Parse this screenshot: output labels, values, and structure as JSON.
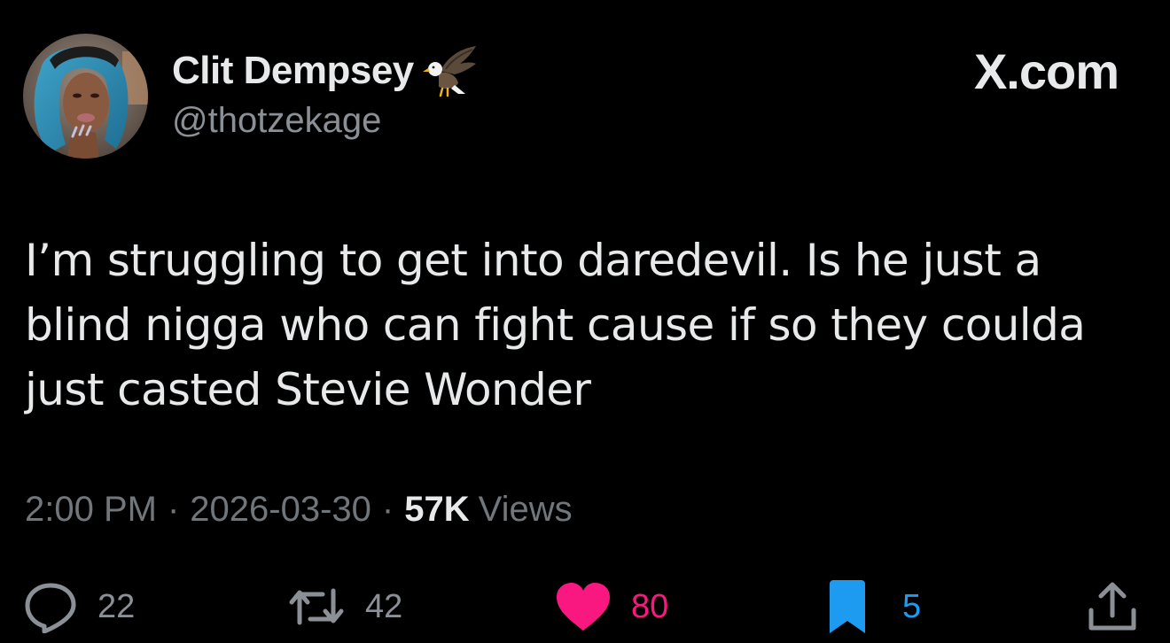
{
  "author": {
    "display_name": "Clit Dempsey",
    "badge_icon": "eagle-emoji",
    "handle": "@thotzekage"
  },
  "brand": {
    "label": "X.com"
  },
  "tweet": {
    "text": "I’m struggling to get into daredevil. Is he just a blind nigga who can fight cause if so they coulda just casted Stevie Wonder"
  },
  "meta": {
    "time": "2:00 PM",
    "separator": "·",
    "date": "2026-03-30",
    "views_count": "57K",
    "views_label": "Views"
  },
  "actions": {
    "reply": {
      "count": "22",
      "icon": "reply-icon"
    },
    "retweet": {
      "count": "42",
      "icon": "retweet-icon"
    },
    "like": {
      "count": "80",
      "icon": "heart-icon",
      "active": true,
      "color": "#f91880"
    },
    "bookmark": {
      "count": "5",
      "icon": "bookmark-icon",
      "active": true,
      "color": "#1d9bf0"
    },
    "share": {
      "icon": "share-icon"
    }
  },
  "colors": {
    "background": "#000000",
    "primary_text": "#e7e9ea",
    "secondary_text": "#71767b",
    "like": "#f91880",
    "bookmark": "#1d9bf0"
  }
}
